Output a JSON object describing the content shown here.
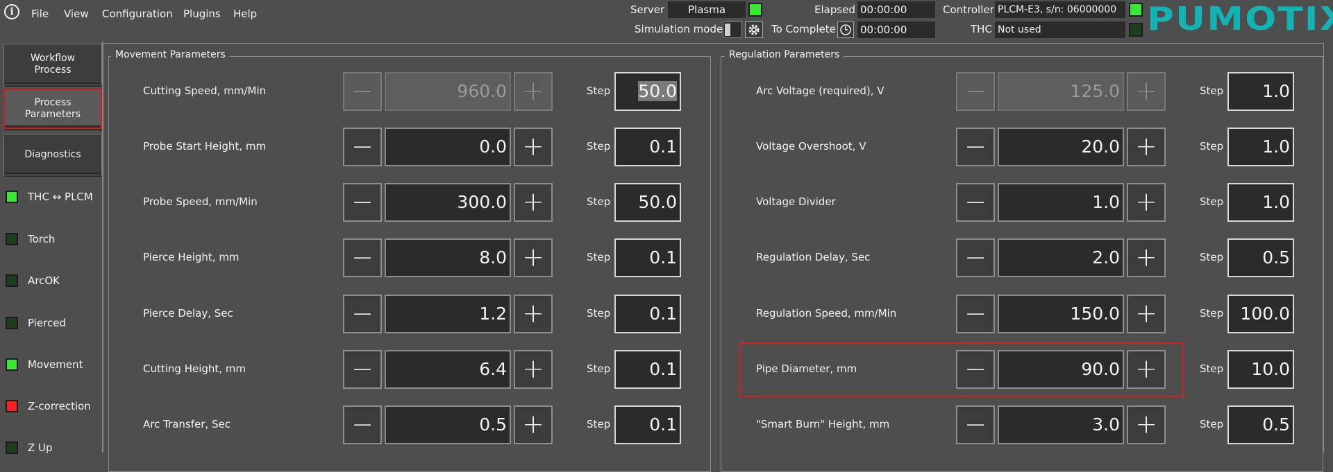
{
  "menu": [
    "File",
    "View",
    "Configuration",
    "Plugins",
    "Help"
  ],
  "topbar": {
    "server_label": "Server",
    "server_value": "Plasma",
    "sim_label": "Simulation mode",
    "elapsed_label": "Elapsed",
    "elapsed_value": "00:00:00",
    "tocomplete_label": "To Complete",
    "tocomplete_value": "00:00:00",
    "controller_label": "Controller",
    "controller_value": "PLCM-E3, s/n: 06000000",
    "thc_label": "THC",
    "thc_value": "Not used",
    "brand": "PUMOTIX"
  },
  "sidebar": {
    "buttons": [
      "Workflow\nProcess",
      "Process\nParameters",
      "Diagnostics"
    ],
    "indicators": [
      {
        "label": "THC ↔ PLCM",
        "state": "on"
      },
      {
        "label": "Torch",
        "state": "off"
      },
      {
        "label": "ArcOK",
        "state": "off"
      },
      {
        "label": "Pierced",
        "state": "off"
      },
      {
        "label": "Movement",
        "state": "on"
      },
      {
        "label": "Z-correction",
        "state": "red"
      },
      {
        "label": "Z Up",
        "state": "off"
      }
    ]
  },
  "movement": {
    "title": "Movement Parameters",
    "step_label": "Step",
    "rows": [
      {
        "label": "Cutting Speed, mm/Min",
        "value": "960.0",
        "step": "50.0"
      },
      {
        "label": "Probe Start Height, mm",
        "value": "0.0",
        "step": "0.1"
      },
      {
        "label": "Probe Speed, mm/Min",
        "value": "300.0",
        "step": "50.0"
      },
      {
        "label": "Pierce Height, mm",
        "value": "8.0",
        "step": "0.1"
      },
      {
        "label": "Pierce Delay, Sec",
        "value": "1.2",
        "step": "0.1"
      },
      {
        "label": "Cutting Height, mm",
        "value": "6.4",
        "step": "0.1"
      },
      {
        "label": "Arc Transfer, Sec",
        "value": "0.5",
        "step": "0.1"
      }
    ]
  },
  "regulation": {
    "title": "Regulation Parameters",
    "step_label": "Step",
    "rows": [
      {
        "label": "Arc Voltage (required), V",
        "value": "125.0",
        "step": "1.0"
      },
      {
        "label": "Voltage Overshoot, V",
        "value": "20.0",
        "step": "1.0"
      },
      {
        "label": "Voltage Divider",
        "value": "1.0",
        "step": "1.0"
      },
      {
        "label": "Regulation Delay, Sec",
        "value": "2.0",
        "step": "0.5"
      },
      {
        "label": "Regulation Speed, mm/Min",
        "value": "150.0",
        "step": "100.0"
      },
      {
        "label": "Pipe Diameter, mm",
        "value": "90.0",
        "step": "10.0"
      },
      {
        "label": "\"Smart Burn\" Height, mm",
        "value": "3.0",
        "step": "0.5"
      }
    ]
  },
  "colors": {
    "accent": "#14b3b3",
    "led_on": "#39e639",
    "led_red": "#ff2020",
    "highlight": "#d22020"
  },
  "icons": {
    "info": "info-icon",
    "gear": "gear-icon",
    "clock": "clock-icon",
    "minus": "minus-icon",
    "plus": "plus-icon"
  }
}
